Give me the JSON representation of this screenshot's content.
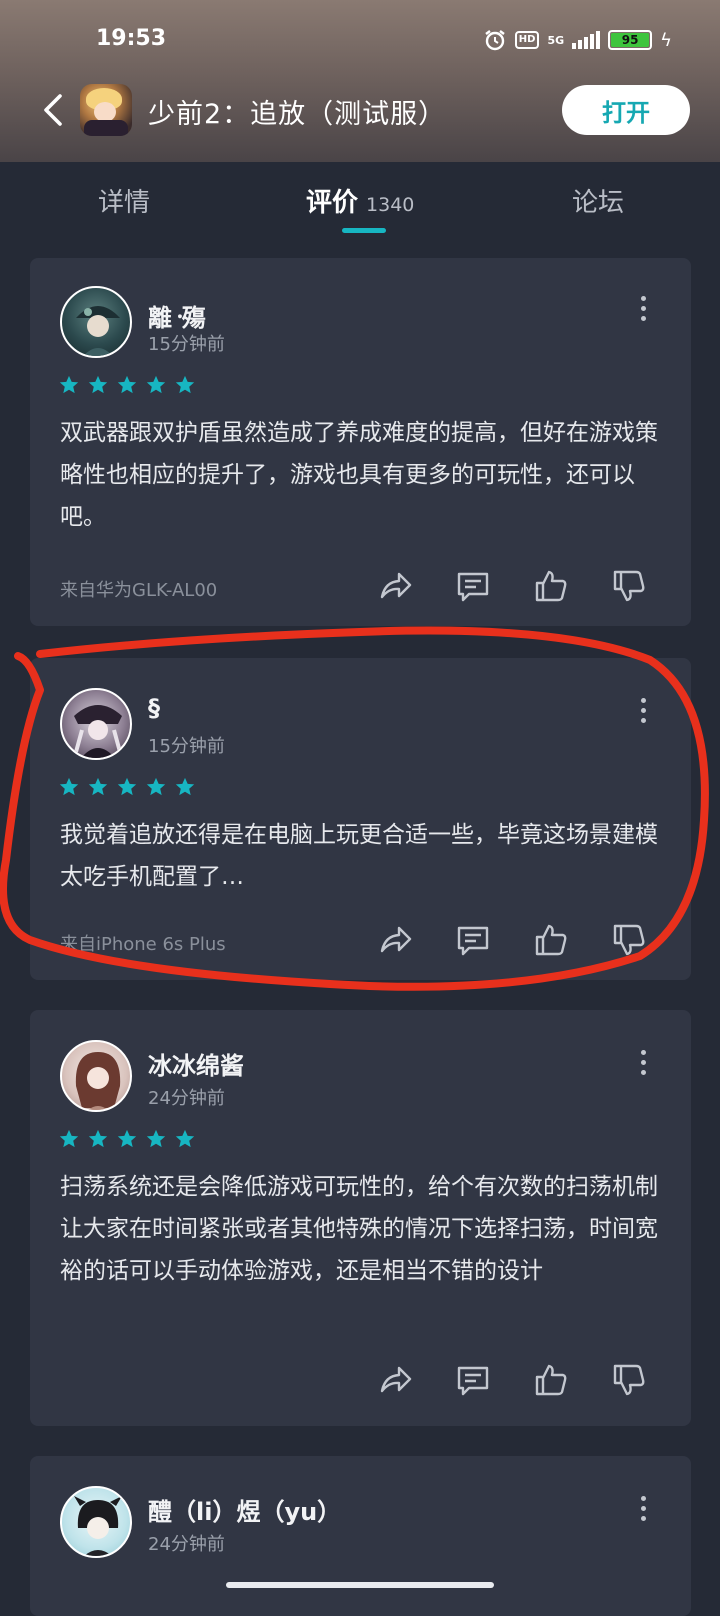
{
  "status": {
    "time": "19:53",
    "network": "5G",
    "hd": "HD",
    "battery": "95"
  },
  "appbar": {
    "title": "少前2：追放（测试服）",
    "open_label": "打开"
  },
  "tabs": [
    {
      "label": "详情"
    },
    {
      "label": "评价",
      "count": "1340"
    },
    {
      "label": "论坛"
    }
  ],
  "reviews": [
    {
      "username": "離᠂殤",
      "time": "15分钟前",
      "stars": 5,
      "text": "双武器跟双护盾虽然造成了养成难度的提高，但好在游戏策略性也相应的提升了，游戏也具有更多的可玩性，还可以吧。",
      "device": "来自华为GLK-AL00"
    },
    {
      "username": "§",
      "time": "15分钟前",
      "stars": 5,
      "text": "我觉着追放还得是在电脑上玩更合适一些，毕竟这场景建模太吃手机配置了…",
      "device": "来自iPhone 6s Plus"
    },
    {
      "username": "冰冰绵酱",
      "time": "24分钟前",
      "stars": 5,
      "text": "扫荡系统还是会降低游戏可玩性的，给个有次数的扫荡机制让大家在时间紧张或者其他特殊的情况下选择扫荡，时间宽裕的话可以手动体验游戏，还是相当不错的设计",
      "device": ""
    },
    {
      "username": "醴（li）煜（yu）",
      "time": "24分钟前"
    }
  ],
  "colors": {
    "accent": "#17b6c2",
    "background": "#252a36",
    "card": "#313644",
    "annotation": "#e8301c"
  }
}
